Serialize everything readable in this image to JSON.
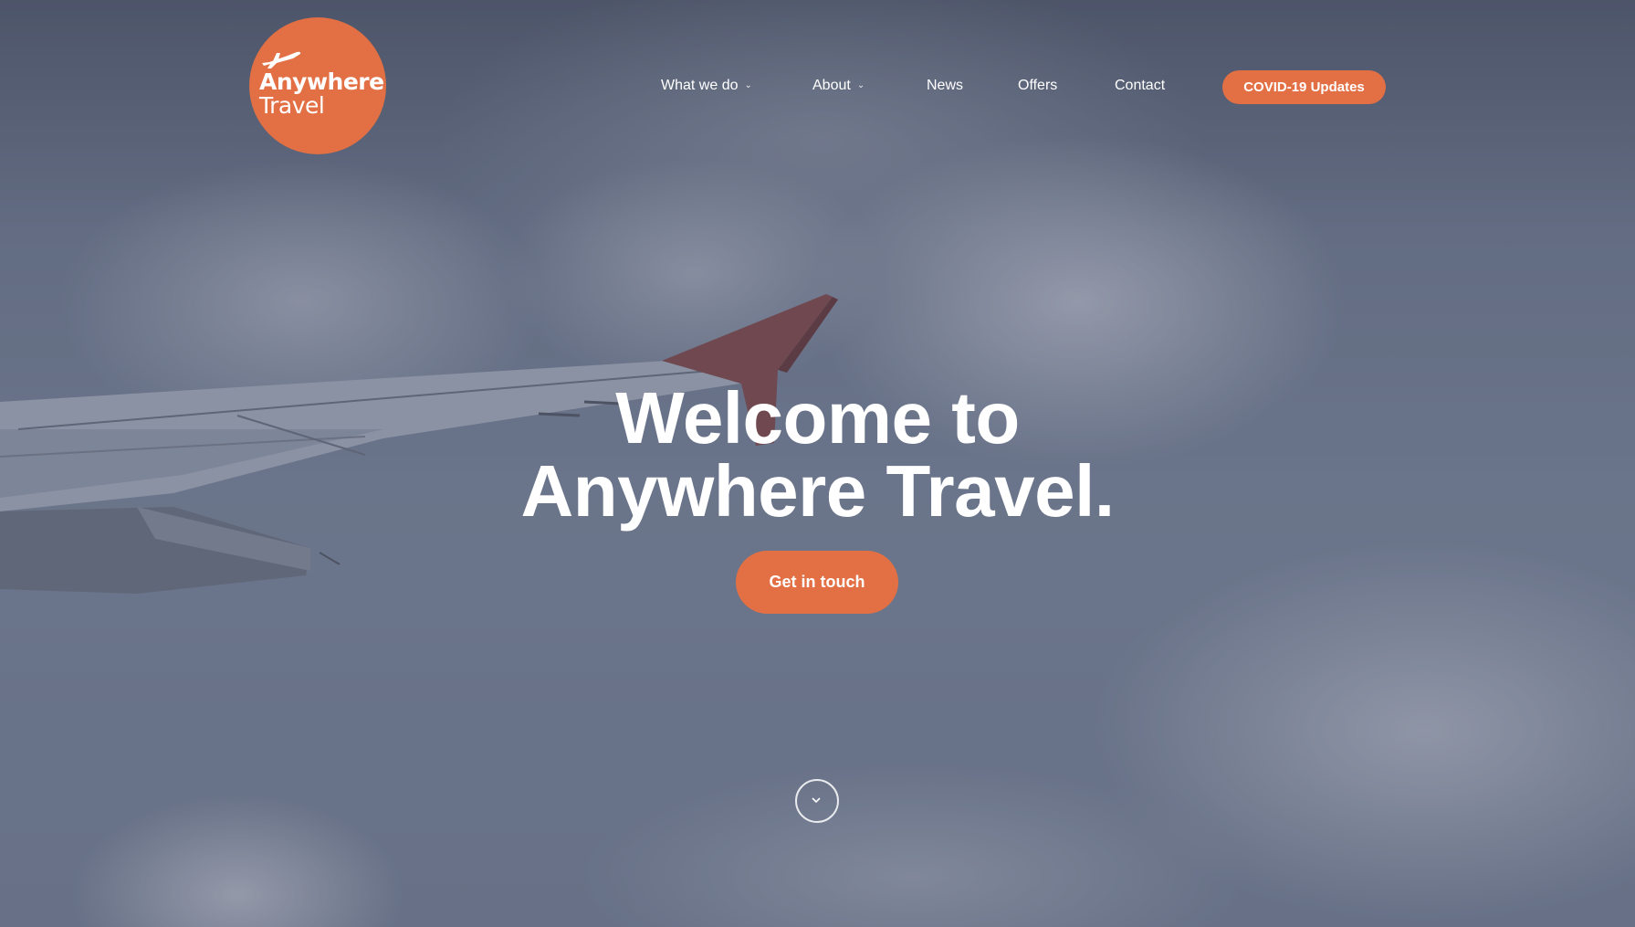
{
  "brand": {
    "logo_line1": "Anywhere",
    "logo_line2": "Travel",
    "logo_icon": "airplane-icon",
    "accent_color": "#e27044"
  },
  "nav": {
    "items": [
      {
        "label": "What we do",
        "has_dropdown": true
      },
      {
        "label": "About",
        "has_dropdown": true
      },
      {
        "label": "News",
        "has_dropdown": false
      },
      {
        "label": "Offers",
        "has_dropdown": false
      },
      {
        "label": "Contact",
        "has_dropdown": false
      }
    ],
    "cta_label": "COVID-19 Updates"
  },
  "hero": {
    "headline_line1": "Welcome to",
    "headline_line2": "Anywhere Travel.",
    "button_label": "Get in touch",
    "scroll_icon": "chevron-down-icon"
  }
}
